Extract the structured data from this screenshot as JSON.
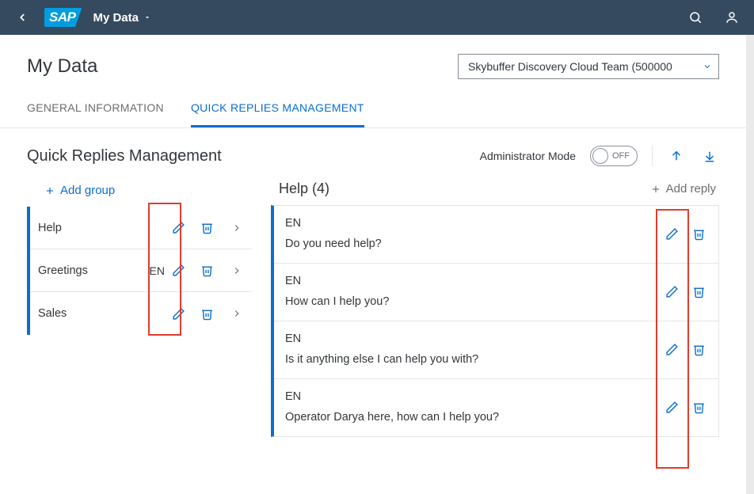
{
  "shell": {
    "title": "My Data"
  },
  "page": {
    "title": "My Data",
    "dropdown_value": "Skybuffer Discovery Cloud Team (500000"
  },
  "tabs": {
    "general": "GENERAL INFORMATION",
    "quick": "QUICK REPLIES MANAGEMENT"
  },
  "section": {
    "title": "Quick Replies Management",
    "admin_label": "Administrator Mode",
    "toggle_text": "OFF",
    "add_group": "Add group"
  },
  "groups": [
    {
      "label": "Help",
      "badge": ""
    },
    {
      "label": "Greetings",
      "badge": "EN"
    },
    {
      "label": "Sales",
      "badge": ""
    }
  ],
  "right": {
    "title": "Help (4)",
    "add_reply": "Add reply"
  },
  "replies": [
    {
      "lang": "EN",
      "text": "Do you need help?"
    },
    {
      "lang": "EN",
      "text": "How can I help you?"
    },
    {
      "lang": "EN",
      "text": "Is it anything else I can help you with?"
    },
    {
      "lang": "EN",
      "text": "Operator Darya here, how can I help you?"
    }
  ]
}
